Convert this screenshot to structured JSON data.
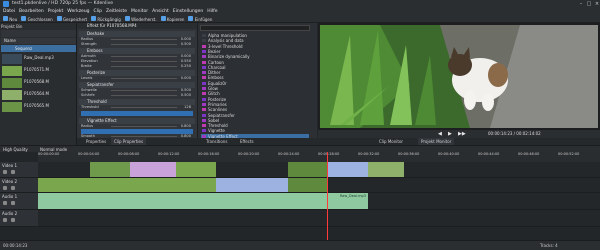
{
  "window": {
    "title": "test1.pkdenlive / HD 720p 25 fps — Kdenlive"
  },
  "menu": [
    "Datei",
    "Bearbeiten",
    "Projekt",
    "Werkzeug",
    "Clip",
    "Zeitleiste",
    "Monitor",
    "Ansicht",
    "Einstellungen",
    "Hilfe"
  ],
  "toolbar": [
    "Neu",
    "Geschlossen",
    "Gespeichert",
    "Rückgängig",
    "Wiederherst.",
    "Kopieren",
    "Einfügen"
  ],
  "bin": {
    "title": "Projekt Bin",
    "column_name": "Name",
    "folder": "Sequenz",
    "clips": [
      "Raw_Deal.mp3",
      "P1070571.M",
      "P1070568.M",
      "P1070564.M",
      "P1070565.M"
    ]
  },
  "effect_stack": {
    "title": "Effekt für P1070568.MP4",
    "groups": [
      {
        "label": "Deshake",
        "params": [
          {
            "name": "Radius",
            "value": "0.000"
          },
          {
            "name": "Strength",
            "value": "0.500"
          }
        ]
      },
      {
        "label": "Emboss",
        "params": [
          {
            "name": "Azimuth",
            "value": "0.000"
          },
          {
            "name": "Elevation",
            "value": "0.550"
          },
          {
            "name": "Breite",
            "value": "0.250"
          }
        ]
      },
      {
        "label": "Posterize",
        "params": [
          {
            "name": "Levels",
            "value": "0.000"
          }
        ]
      },
      {
        "label": "Sepiatransfer",
        "params": [
          {
            "name": "Schwelle",
            "value": "0.500"
          },
          {
            "name": "Schärfe",
            "value": "0.500"
          }
        ]
      },
      {
        "label": "Threshold",
        "params": [
          {
            "name": "Threshold",
            "value": "128"
          }
        ]
      },
      {
        "label": "Vignette Effect",
        "params": [
          {
            "name": "Radius",
            "value": "0.800"
          },
          {
            "name": "Smooth",
            "value": "0.800"
          }
        ]
      }
    ]
  },
  "effects_list": {
    "items": [
      {
        "label": "Alpha manipulation",
        "color": "#3a3f45"
      },
      {
        "label": "Analysis and data",
        "color": "#3a3f45"
      },
      {
        "label": "3-level Threshold",
        "color": "#c03ab0"
      },
      {
        "label": "Bezier",
        "color": "#7b36c9"
      },
      {
        "label": "Binarize dynamically",
        "color": "#a03ac3"
      },
      {
        "label": "Cartoon",
        "color": "#c03ab0"
      },
      {
        "label": "Charcoal",
        "color": "#7b36c9"
      },
      {
        "label": "Dither",
        "color": "#a03ac3"
      },
      {
        "label": "Emboss",
        "color": "#c03ab0"
      },
      {
        "label": "Equaliz0r",
        "color": "#7b36c9"
      },
      {
        "label": "Glow",
        "color": "#a03ac3"
      },
      {
        "label": "Glitch",
        "color": "#c03ab0"
      },
      {
        "label": "Posterize",
        "color": "#7b36c9"
      },
      {
        "label": "Primaries",
        "color": "#a03ac3"
      },
      {
        "label": "Scanlines",
        "color": "#c03ab0"
      },
      {
        "label": "Sepiatransfer",
        "color": "#7b36c9"
      },
      {
        "label": "Sobel",
        "color": "#a03ac3"
      },
      {
        "label": "Threshold",
        "color": "#c03ab0"
      },
      {
        "label": "Vignette",
        "color": "#7b36c9"
      },
      {
        "label": "Vignette Effect",
        "color": "#a03ac3"
      },
      {
        "label": "Audio",
        "color": "#3a3f45"
      }
    ],
    "selected_index": 19
  },
  "monitor": {
    "timecode": "00:00:14:23 / 00:02:14:02",
    "tabs": [
      "Clip Monitor",
      "Projekt Monitor"
    ]
  },
  "middle_tabs": [
    "Properties",
    "Clip Properties",
    "Transitions",
    "Effects"
  ],
  "timeline": {
    "toolbar": [
      "High Quality",
      "Normal mode"
    ],
    "ruler": [
      "00:00:00:00",
      "00:00:04:00",
      "00:00:08:00",
      "00:00:12:00",
      "00:00:16:00",
      "00:00:20:00",
      "00:00:24:00",
      "00:00:28:00",
      "00:00:32:00",
      "00:00:36:00",
      "00:00:40:00",
      "00:00:44:00",
      "00:00:48:00",
      "00:00:52:00"
    ],
    "tracks": [
      "Video 1",
      "Video 2",
      "Audio 1",
      "Audio 2"
    ],
    "audio_clip_label": "Raw_Deal.mp3"
  },
  "status": {
    "left": "00:00:14:23",
    "right": "Tracks: 4"
  }
}
